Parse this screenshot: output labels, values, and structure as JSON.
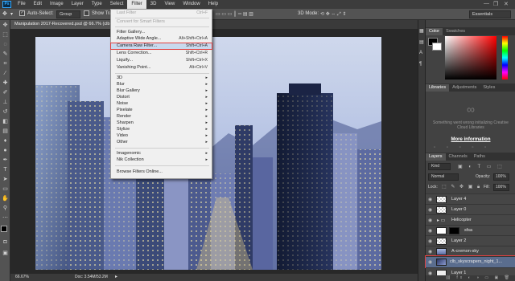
{
  "menubar": {
    "logo": "Ps",
    "items": [
      "File",
      "Edit",
      "Image",
      "Layer",
      "Type",
      "Select",
      "Filter",
      "3D",
      "View",
      "Window",
      "Help"
    ],
    "active": "Filter"
  },
  "options": {
    "auto_select_label": "Auto-Select:",
    "auto_select_value": "Group",
    "show_transform_label": "Show Tra",
    "mode_3d_label": "3D Mode:",
    "workspace": "Essentials"
  },
  "document": {
    "tab_title": "Manipulation 2017-Recovered.psd @ 66.7% (clb",
    "zoom": "66.67%",
    "doc_size": "Doc: 3.54M/53.2M"
  },
  "filter_menu": {
    "last_filter": {
      "label": "Last Filter",
      "shortcut": "Ctrl+F"
    },
    "smart": "Convert for Smart Filters",
    "gallery": "Filter Gallery...",
    "adaptive": {
      "label": "Adaptive Wide Angle...",
      "shortcut": "Alt+Shift+Ctrl+A"
    },
    "camera_raw": {
      "label": "Camera Raw Filter...",
      "shortcut": "Shift+Ctrl+A"
    },
    "lens": {
      "label": "Lens Correction...",
      "shortcut": "Shift+Ctrl+R"
    },
    "liquify": {
      "label": "Liquify...",
      "shortcut": "Shift+Ctrl+X"
    },
    "vanishing": {
      "label": "Vanishing Point...",
      "shortcut": "Alt+Ctrl+V"
    },
    "groups": [
      "3D",
      "Blur",
      "Blur Gallery",
      "Distort",
      "Noise",
      "Pixelate",
      "Render",
      "Sharpen",
      "Stylize",
      "Video",
      "Other"
    ],
    "plugins": [
      "Imagenomic",
      "Nik Collection"
    ],
    "browse": "Browse Filters Online..."
  },
  "color_panel": {
    "tabs": [
      "Color",
      "Swatches"
    ]
  },
  "libraries_panel": {
    "tabs": [
      "Libraries",
      "Adjustments",
      "Styles"
    ],
    "message": "Something went wrong initializing Creative Cloud Libraries",
    "link": "More information"
  },
  "layers_panel": {
    "tabs": [
      "Layers",
      "Channels",
      "Paths"
    ],
    "kind": "Kind",
    "blend_mode": "Normal",
    "opacity_label": "Opacity:",
    "opacity_value": "100%",
    "lock_label": "Lock:",
    "fill_label": "Fill:",
    "fill_value": "100%",
    "layers": [
      "Layer 4",
      "Layer 0",
      "Helicopter",
      "sfsa",
      "Layer 2",
      "A-cremon-sky",
      "clb_skyscrapers_night_1...",
      "Layer 1"
    ],
    "selected": "clb_skyscrapers_night_1..."
  },
  "colors": {
    "accent": "#31a8ff",
    "highlight_border": "#e04040",
    "menu_bg": "#f0f0f0"
  }
}
